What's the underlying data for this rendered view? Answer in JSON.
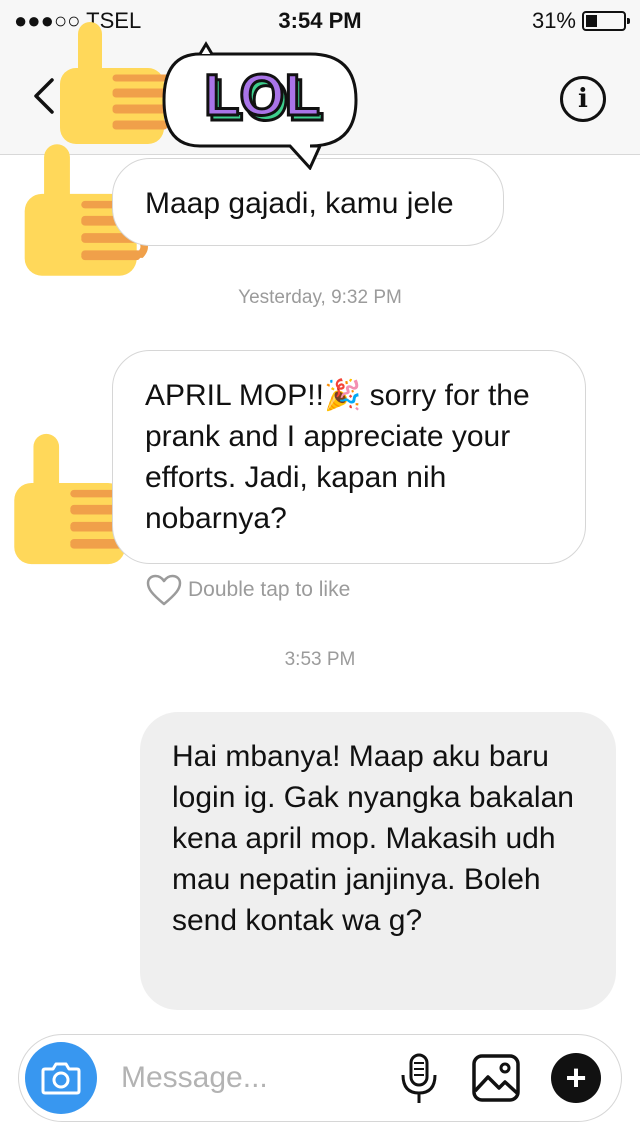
{
  "status_bar": {
    "carrier": "●●●○○ TSEL",
    "time": "3:54 PM",
    "battery_percent": "31%",
    "battery_level": 0.31
  },
  "nav": {
    "back_icon": "chevron-left-icon",
    "info_icon": "info-icon",
    "info_glyph": "i"
  },
  "sticker": {
    "text": "LOL",
    "colors": {
      "fill": "#a974e8",
      "shade": "#3ecf8e"
    }
  },
  "messages": [
    {
      "direction": "incoming",
      "text": "Maap gajadi, kamu jele"
    },
    {
      "type": "timestamp",
      "text": "Yesterday, 9:32 PM"
    },
    {
      "direction": "incoming",
      "text_before": "APRIL MOP!!",
      "emoji": "🎉",
      "text_after": " sorry for the prank and I appreciate your efforts. Jadi, kapan nih nobarnya?"
    },
    {
      "type": "like_hint",
      "text": "Double tap to like"
    },
    {
      "type": "timestamp",
      "text": "3:53 PM"
    },
    {
      "direction": "outgoing",
      "text": "Hai mbanya! Maap aku baru login ig. Gak nyangka bakalan kena april mop. Makasih udh mau nepatin janjinya. Boleh send kontak wa g?"
    }
  ],
  "composer": {
    "placeholder": "Message...",
    "value": "",
    "camera_icon": "camera-icon",
    "mic_icon": "microphone-icon",
    "gallery_icon": "gallery-icon",
    "plus_icon": "plus-icon",
    "plus_glyph": "+",
    "accent": "#3897f0"
  }
}
